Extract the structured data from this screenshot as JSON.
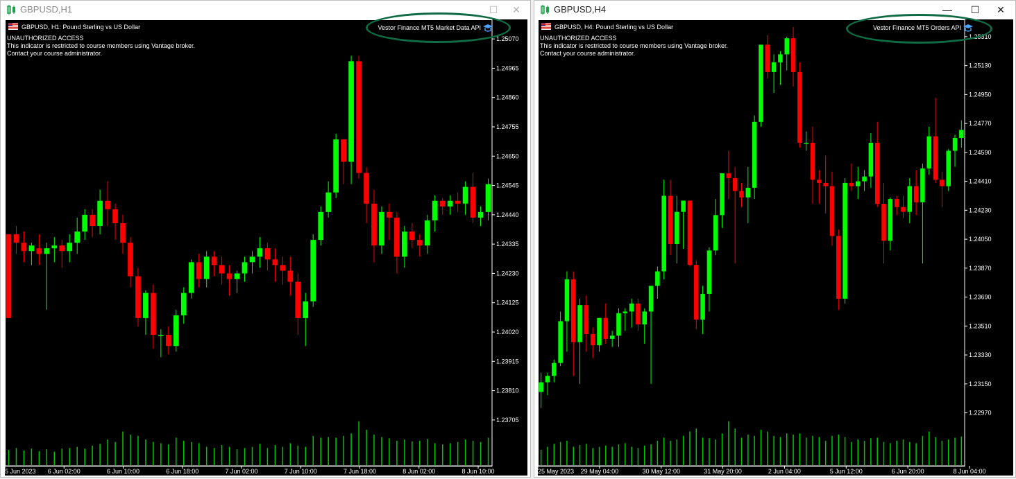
{
  "windows": [
    {
      "title": "GBPUSD,H1",
      "controls": {
        "maximize": "☐",
        "close": "✕"
      },
      "header": {
        "symbol_line": "GBPUSD, H1:  Pound Sterling vs US Dollar",
        "badge": "Vestor Finance MT5 Market Data API"
      },
      "warning": [
        "UNAUTHORIZED ACCESS",
        "This indicator is restricted to course members using Vantage broker.",
        "Contact your course administrator."
      ],
      "chart_data": {
        "type": "candlestick",
        "symbol": "GBPUSD",
        "timeframe": "H1",
        "ylim": [
          1.2365,
          1.2513
        ],
        "y_ticks": [
          "1.25070",
          "1.24965",
          "1.24860",
          "1.24755",
          "1.24650",
          "1.24545",
          "1.24440",
          "1.24335",
          "1.24230",
          "1.24125",
          "1.24020",
          "1.23915",
          "1.23810",
          "1.23705"
        ],
        "x_ticks": [
          "5 Jun 2023",
          "6 Jun 02:00",
          "6 Jun 10:00",
          "6 Jun 18:00",
          "7 Jun 02:00",
          "7 Jun 10:00",
          "7 Jun 18:00",
          "8 Jun 02:00",
          "8 Jun 10:00"
        ],
        "up_color": "#00ff00",
        "down_color": "#ff0000",
        "volume_color": "#00c800",
        "candles": [
          [
            1.2437,
            1.2437,
            1.2407,
            1.2407
          ],
          [
            1.2437,
            1.244,
            1.243,
            1.2434
          ],
          [
            1.2434,
            1.2438,
            1.2427,
            1.2431
          ],
          [
            1.2431,
            1.2434,
            1.2426,
            1.2433
          ],
          [
            1.2432,
            1.2437,
            1.2426,
            1.243
          ],
          [
            1.243,
            1.2434,
            1.241,
            1.2432
          ],
          [
            1.2432,
            1.2436,
            1.2427,
            1.2433
          ],
          [
            1.2433,
            1.2435,
            1.2425,
            1.2431
          ],
          [
            1.2431,
            1.2437,
            1.2427,
            1.2434
          ],
          [
            1.2434,
            1.2443,
            1.243,
            1.2438
          ],
          [
            1.2438,
            1.2446,
            1.2435,
            1.2444
          ],
          [
            1.2444,
            1.2446,
            1.2436,
            1.244
          ],
          [
            1.244,
            1.2453,
            1.2437,
            1.2449
          ],
          [
            1.2449,
            1.2456,
            1.244,
            1.2446
          ],
          [
            1.2446,
            1.2448,
            1.2435,
            1.2441
          ],
          [
            1.2441,
            1.2444,
            1.243,
            1.2434
          ],
          [
            1.2434,
            1.2436,
            1.2418,
            1.2422
          ],
          [
            1.2422,
            1.2425,
            1.2404,
            1.2407
          ],
          [
            1.2407,
            1.2417,
            1.2401,
            1.2416
          ],
          [
            1.2416,
            1.2419,
            1.2396,
            1.2401
          ],
          [
            1.2401,
            1.2403,
            1.2393,
            1.2401
          ],
          [
            1.2401,
            1.2404,
            1.2394,
            1.2397
          ],
          [
            1.2397,
            1.241,
            1.2395,
            1.2408
          ],
          [
            1.2408,
            1.2418,
            1.2405,
            1.2416
          ],
          [
            1.2416,
            1.2428,
            1.2414,
            1.2427
          ],
          [
            1.2427,
            1.243,
            1.2418,
            1.2421
          ],
          [
            1.2421,
            1.2431,
            1.2418,
            1.2429
          ],
          [
            1.2429,
            1.2431,
            1.2422,
            1.2426
          ],
          [
            1.2426,
            1.2429,
            1.2419,
            1.2423
          ],
          [
            1.2423,
            1.2426,
            1.2415,
            1.2421
          ],
          [
            1.2421,
            1.2424,
            1.2416,
            1.2423
          ],
          [
            1.2423,
            1.2429,
            1.242,
            1.2427
          ],
          [
            1.2427,
            1.2431,
            1.2423,
            1.2429
          ],
          [
            1.2429,
            1.2436,
            1.2425,
            1.2432
          ],
          [
            1.2432,
            1.2434,
            1.2424,
            1.2428
          ],
          [
            1.2428,
            1.2432,
            1.242,
            1.2426
          ],
          [
            1.2426,
            1.2429,
            1.2419,
            1.2424
          ],
          [
            1.2424,
            1.2429,
            1.2415,
            1.242
          ],
          [
            1.242,
            1.2423,
            1.2401,
            1.2407
          ],
          [
            1.2407,
            1.2416,
            1.2397,
            1.2413
          ],
          [
            1.2413,
            1.2437,
            1.2411,
            1.2435
          ],
          [
            1.2435,
            1.2447,
            1.2433,
            1.2445
          ],
          [
            1.2445,
            1.2456,
            1.2443,
            1.2452
          ],
          [
            1.2452,
            1.2473,
            1.245,
            1.2471
          ],
          [
            1.2471,
            1.2471,
            1.2455,
            1.2463
          ],
          [
            1.2463,
            1.2501,
            1.2455,
            1.2499
          ],
          [
            1.2499,
            1.2501,
            1.2457,
            1.2459
          ],
          [
            1.2459,
            1.2461,
            1.2441,
            1.2448
          ],
          [
            1.2448,
            1.2453,
            1.2427,
            1.2433
          ],
          [
            1.2433,
            1.2447,
            1.243,
            1.2445
          ],
          [
            1.2445,
            1.2448,
            1.2435,
            1.2443
          ],
          [
            1.2443,
            1.2445,
            1.2423,
            1.2429
          ],
          [
            1.2429,
            1.244,
            1.2425,
            1.2438
          ],
          [
            1.2438,
            1.2441,
            1.2432,
            1.2435
          ],
          [
            1.2435,
            1.2437,
            1.2429,
            1.2433
          ],
          [
            1.2433,
            1.2444,
            1.243,
            1.2442
          ],
          [
            1.2442,
            1.2451,
            1.2438,
            1.2449
          ],
          [
            1.2449,
            1.245,
            1.2444,
            1.2447
          ],
          [
            1.2447,
            1.2451,
            1.2444,
            1.2449
          ],
          [
            1.2449,
            1.2452,
            1.2445,
            1.2448
          ],
          [
            1.2448,
            1.2456,
            1.2444,
            1.2454
          ],
          [
            1.2454,
            1.2459,
            1.2441,
            1.2443
          ],
          [
            1.2443,
            1.2447,
            1.244,
            1.2445
          ],
          [
            1.2445,
            1.2457,
            1.2442,
            1.2455
          ]
        ],
        "volumes": [
          0.25,
          0.28,
          0.24,
          0.27,
          0.23,
          0.26,
          0.22,
          0.27,
          0.28,
          0.3,
          0.27,
          0.32,
          0.35,
          0.42,
          0.38,
          0.55,
          0.5,
          0.48,
          0.42,
          0.38,
          0.36,
          0.34,
          0.45,
          0.4,
          0.38,
          0.36,
          0.3,
          0.28,
          0.33,
          0.3,
          0.26,
          0.28,
          0.3,
          0.35,
          0.28,
          0.33,
          0.3,
          0.36,
          0.32,
          0.3,
          0.48,
          0.45,
          0.46,
          0.45,
          0.48,
          0.52,
          0.72,
          0.58,
          0.5,
          0.46,
          0.44,
          0.4,
          0.42,
          0.39,
          0.4,
          0.43,
          0.36,
          0.34,
          0.36,
          0.38,
          0.42,
          0.4,
          0.38,
          0.45
        ]
      }
    },
    {
      "title": "GBPUSD,H4",
      "controls": {
        "minimize": "—",
        "maximize": "☐",
        "close": "✕"
      },
      "header": {
        "symbol_line": "GBPUSD, H4:  Pound Sterling vs US Dollar",
        "badge": "Vestor Finance MT5 Orders API"
      },
      "warning": [
        "UNAUTHORIZED ACCESS",
        "This indicator is restricted to course members using Vantage broker.",
        "Contact your course administrator."
      ],
      "chart_data": {
        "type": "candlestick",
        "symbol": "GBPUSD",
        "timeframe": "H4",
        "ylim": [
          1.2283,
          1.254
        ],
        "y_ticks": [
          "1.25310",
          "1.25130",
          "1.24950",
          "1.24770",
          "1.24590",
          "1.24410",
          "1.24230",
          "1.24050",
          "1.23870",
          "1.23690",
          "1.23510",
          "1.23330",
          "1.23150",
          "1.22970"
        ],
        "x_ticks": [
          "25 May 2023",
          "29 May 04:00",
          "30 May 12:00",
          "31 May 20:00",
          "2 Jun 04:00",
          "5 Jun 12:00",
          "6 Jun 20:00",
          "8 Jun 04:00"
        ],
        "up_color": "#00ff00",
        "down_color": "#ff0000",
        "volume_color": "#00c800",
        "candles": [
          [
            1.231,
            1.2322,
            1.23,
            1.2316
          ],
          [
            1.2316,
            1.2322,
            1.2308,
            1.232
          ],
          [
            1.232,
            1.233,
            1.2316,
            1.2328
          ],
          [
            1.2328,
            1.236,
            1.2326,
            1.2354
          ],
          [
            1.2354,
            1.2385,
            1.2335,
            1.238
          ],
          [
            1.238,
            1.2385,
            1.232,
            1.2341
          ],
          [
            1.2341,
            1.2368,
            1.2315,
            1.2364
          ],
          [
            1.2364,
            1.237,
            1.2335,
            1.2346
          ],
          [
            1.2346,
            1.235,
            1.2331,
            1.2339
          ],
          [
            1.2339,
            1.2356,
            1.2335,
            1.2356
          ],
          [
            1.2356,
            1.2365,
            1.234,
            1.2343
          ],
          [
            1.2343,
            1.2348,
            1.2338,
            1.2345
          ],
          [
            1.2345,
            1.2362,
            1.2338,
            1.2359
          ],
          [
            1.2359,
            1.2362,
            1.2348,
            1.236
          ],
          [
            1.236,
            1.2368,
            1.235,
            1.2365
          ],
          [
            1.2365,
            1.2368,
            1.2348,
            1.2352
          ],
          [
            1.2352,
            1.2362,
            1.234,
            1.236
          ],
          [
            1.236,
            1.237,
            1.2315,
            1.2376
          ],
          [
            1.2376,
            1.2388,
            1.2368,
            1.2385
          ],
          [
            1.2385,
            1.2442,
            1.238,
            1.2432
          ],
          [
            1.2432,
            1.2442,
            1.2395,
            1.2402
          ],
          [
            1.2402,
            1.2432,
            1.239,
            1.2422
          ],
          [
            1.2422,
            1.2425,
            1.2399,
            1.2429
          ],
          [
            1.2429,
            1.2429,
            1.2388,
            1.2389
          ],
          [
            1.2389,
            1.2392,
            1.2349,
            1.2355
          ],
          [
            1.2355,
            1.2376,
            1.2346,
            1.2371
          ],
          [
            1.2371,
            1.24,
            1.236,
            1.2398
          ],
          [
            1.2398,
            1.243,
            1.2395,
            1.242
          ],
          [
            1.242,
            1.244,
            1.2412,
            1.2446
          ],
          [
            1.2446,
            1.246,
            1.243,
            1.2443
          ],
          [
            1.2443,
            1.245,
            1.239,
            1.2435
          ],
          [
            1.2435,
            1.244,
            1.2425,
            1.2431
          ],
          [
            1.2431,
            1.245,
            1.2415,
            1.2437
          ],
          [
            1.2437,
            1.2482,
            1.243,
            1.2478
          ],
          [
            1.2478,
            1.2521,
            1.2475,
            1.2526
          ],
          [
            1.2526,
            1.2532,
            1.2505,
            1.2509
          ],
          [
            1.2509,
            1.252,
            1.2496,
            1.2515
          ],
          [
            1.2515,
            1.2522,
            1.2501,
            1.252
          ],
          [
            1.252,
            1.2531,
            1.251,
            1.253
          ],
          [
            1.253,
            1.2537,
            1.25,
            1.2509
          ],
          [
            1.2509,
            1.2515,
            1.2462,
            1.2465
          ],
          [
            1.2465,
            1.2472,
            1.246,
            1.2465
          ],
          [
            1.2465,
            1.2475,
            1.2427,
            1.2442
          ],
          [
            1.2442,
            1.2448,
            1.2427,
            1.244
          ],
          [
            1.244,
            1.2457,
            1.2421,
            1.2438
          ],
          [
            1.2438,
            1.2447,
            1.2401,
            1.2407
          ],
          [
            1.2407,
            1.2411,
            1.2361,
            1.2368
          ],
          [
            1.2368,
            1.2443,
            1.2365,
            1.244
          ],
          [
            1.244,
            1.2452,
            1.2435,
            1.2438
          ],
          [
            1.2438,
            1.245,
            1.243,
            1.2441
          ],
          [
            1.2441,
            1.2448,
            1.2435,
            1.2444
          ],
          [
            1.2444,
            1.2471,
            1.2437,
            1.2465
          ],
          [
            1.2465,
            1.2478,
            1.2425,
            1.2427
          ],
          [
            1.2427,
            1.244,
            1.239,
            1.2404
          ],
          [
            1.2404,
            1.2431,
            1.2398,
            1.243
          ],
          [
            1.243,
            1.2432,
            1.242,
            1.2425
          ],
          [
            1.2425,
            1.2432,
            1.2418,
            1.2422
          ],
          [
            1.2422,
            1.2443,
            1.2415,
            1.2438
          ],
          [
            1.2438,
            1.2448,
            1.242,
            1.2428
          ],
          [
            1.2428,
            1.2452,
            1.239,
            1.2449
          ],
          [
            1.2449,
            1.2475,
            1.2445,
            1.2469
          ],
          [
            1.2469,
            1.2493,
            1.244,
            1.2442
          ],
          [
            1.2442,
            1.2447,
            1.2425,
            1.2438
          ],
          [
            1.2438,
            1.2461,
            1.2435,
            1.246
          ],
          [
            1.246,
            1.247,
            1.245,
            1.2468
          ],
          [
            1.2468,
            1.2479,
            1.2462,
            1.2473
          ]
        ],
        "volumes": [
          0.25,
          0.3,
          0.35,
          0.38,
          0.4,
          0.3,
          0.33,
          0.35,
          0.28,
          0.3,
          0.32,
          0.3,
          0.34,
          0.36,
          0.3,
          0.28,
          0.32,
          0.34,
          0.4,
          0.45,
          0.4,
          0.42,
          0.48,
          0.55,
          0.6,
          0.45,
          0.44,
          0.42,
          0.52,
          0.72,
          0.6,
          0.45,
          0.5,
          0.48,
          0.58,
          0.55,
          0.48,
          0.46,
          0.52,
          0.5,
          0.52,
          0.45,
          0.48,
          0.46,
          0.4,
          0.48,
          0.5,
          0.46,
          0.38,
          0.42,
          0.4,
          0.44,
          0.45,
          0.38,
          0.36,
          0.4,
          0.42,
          0.38,
          0.36,
          0.48,
          0.55,
          0.46,
          0.4,
          0.42,
          0.45,
          0.47
        ]
      }
    }
  ]
}
